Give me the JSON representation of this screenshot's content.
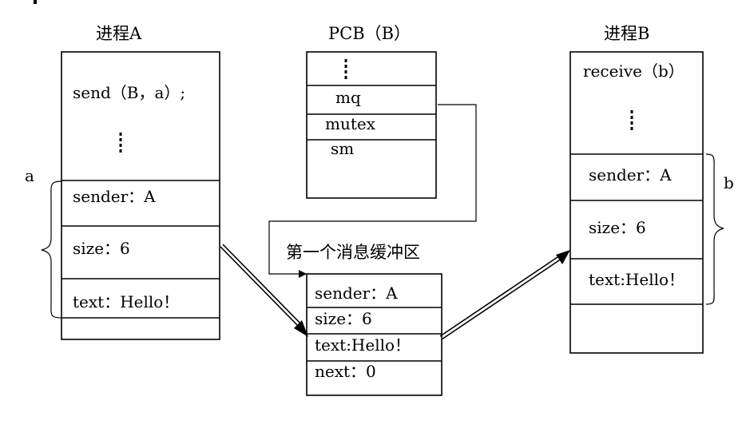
{
  "process_a": {
    "title": "进程A",
    "send_call": "send（B，a）;",
    "ellipsis": "⋮",
    "sender": "sender：A",
    "size": "size：6",
    "text": "text：Hello！",
    "brace_label": "a"
  },
  "pcb": {
    "title": "PCB（B）",
    "ellipsis": "⋮",
    "mq": "mq",
    "mutex": "mutex",
    "sm": "sm"
  },
  "buffer": {
    "title": "第一个消息缓冲区",
    "sender": "sender：A",
    "size": "size：6",
    "text": "text:Hello！",
    "next": "next：0"
  },
  "process_b": {
    "title": "进程B",
    "receive_call": "receive（b）",
    "ellipsis": "⋮",
    "sender": "sender：A",
    "size": "size：6",
    "text": "text:Hello！",
    "brace_label": "b"
  }
}
